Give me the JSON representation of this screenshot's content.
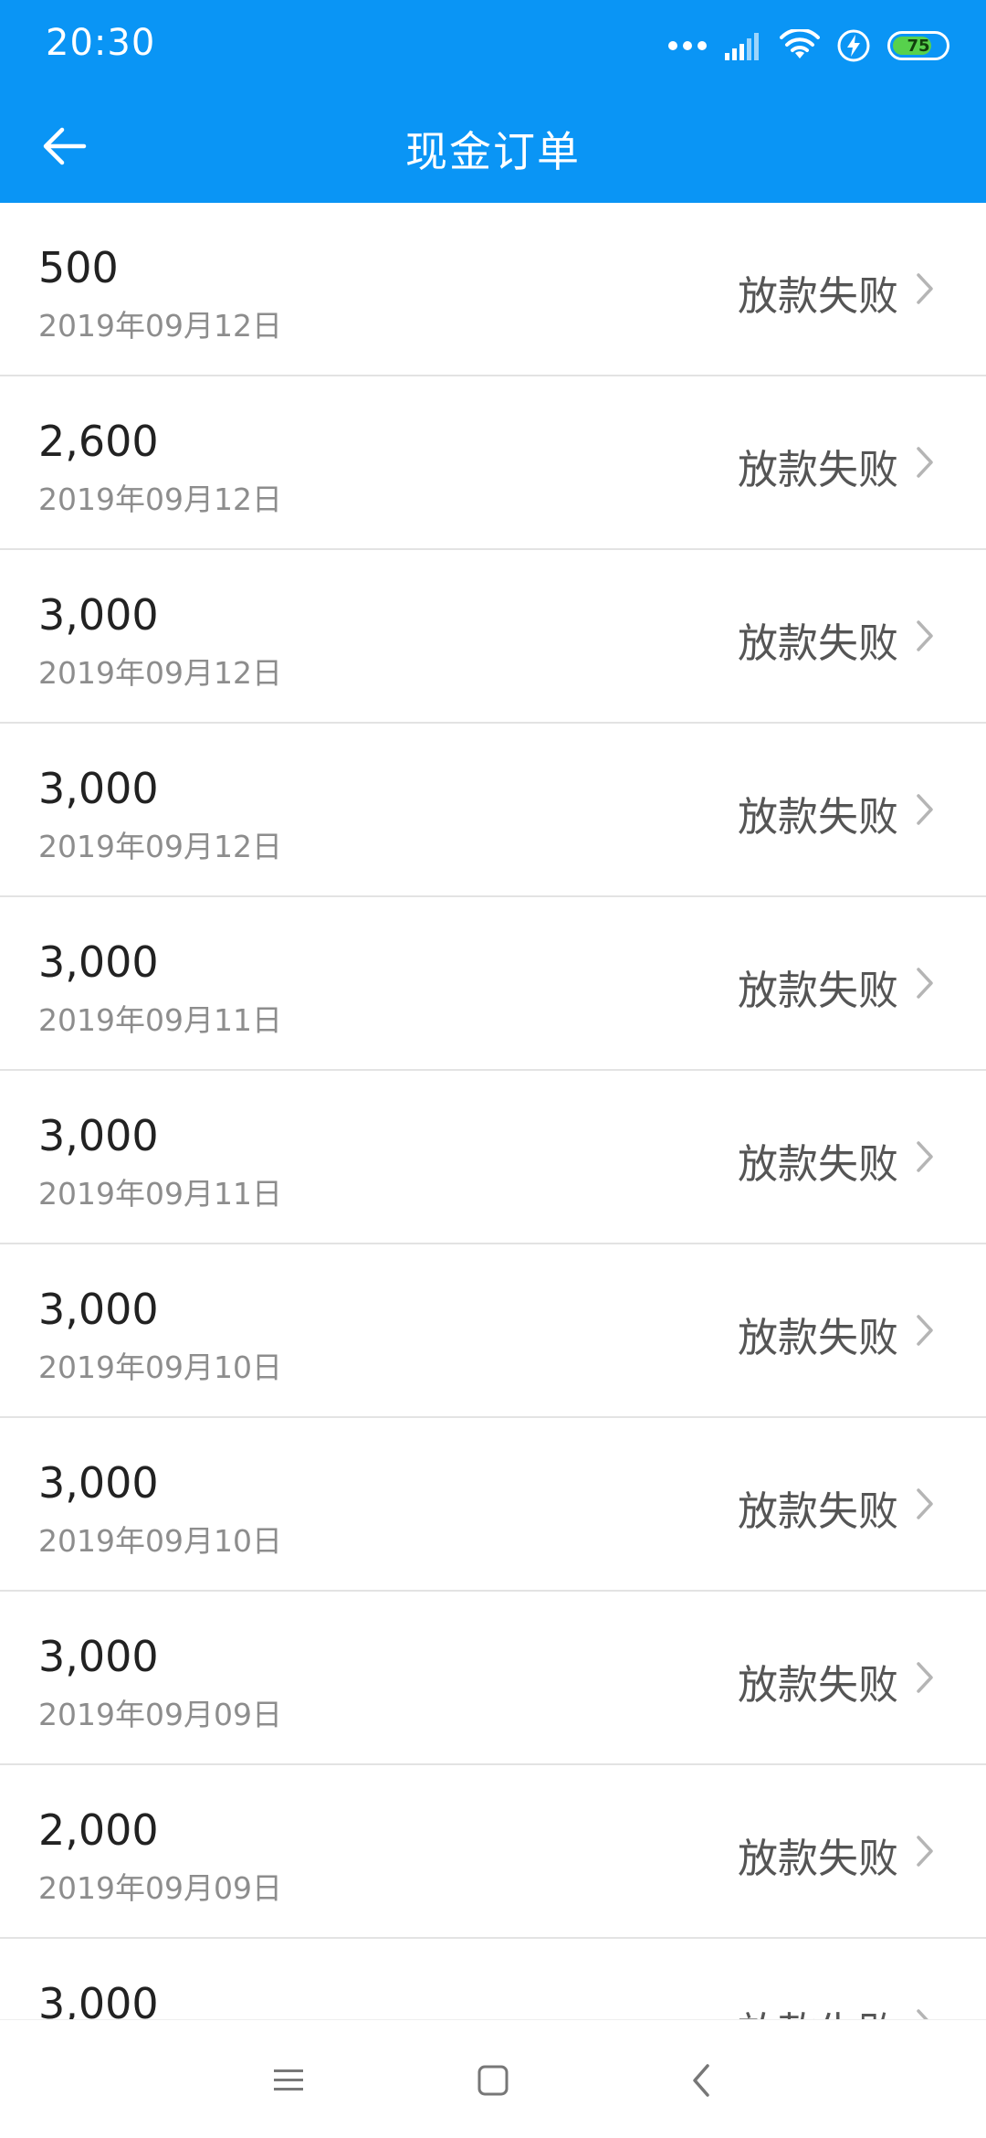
{
  "status_bar": {
    "time": "20:30",
    "battery_level": "75",
    "battery_fraction": 0.75,
    "icons": [
      "more-dots-icon",
      "signal-icon",
      "wifi-icon",
      "charging-icon",
      "battery-icon"
    ]
  },
  "header": {
    "title": "现金订单",
    "back_icon": "arrow-left-icon",
    "color": "#0A95F5"
  },
  "orders": [
    {
      "amount": "500",
      "date": "2019年09月12日",
      "status": "放款失败"
    },
    {
      "amount": "2,600",
      "date": "2019年09月12日",
      "status": "放款失败"
    },
    {
      "amount": "3,000",
      "date": "2019年09月12日",
      "status": "放款失败"
    },
    {
      "amount": "3,000",
      "date": "2019年09月12日",
      "status": "放款失败"
    },
    {
      "amount": "3,000",
      "date": "2019年09月11日",
      "status": "放款失败"
    },
    {
      "amount": "3,000",
      "date": "2019年09月11日",
      "status": "放款失败"
    },
    {
      "amount": "3,000",
      "date": "2019年09月10日",
      "status": "放款失败"
    },
    {
      "amount": "3,000",
      "date": "2019年09月10日",
      "status": "放款失败"
    },
    {
      "amount": "3,000",
      "date": "2019年09月09日",
      "status": "放款失败"
    },
    {
      "amount": "2,000",
      "date": "2019年09月09日",
      "status": "放款失败"
    },
    {
      "amount": "3,000",
      "date": "",
      "status": "放款失败"
    }
  ],
  "system_nav": {
    "buttons": [
      "menu-icon",
      "home-icon",
      "back-icon"
    ]
  }
}
